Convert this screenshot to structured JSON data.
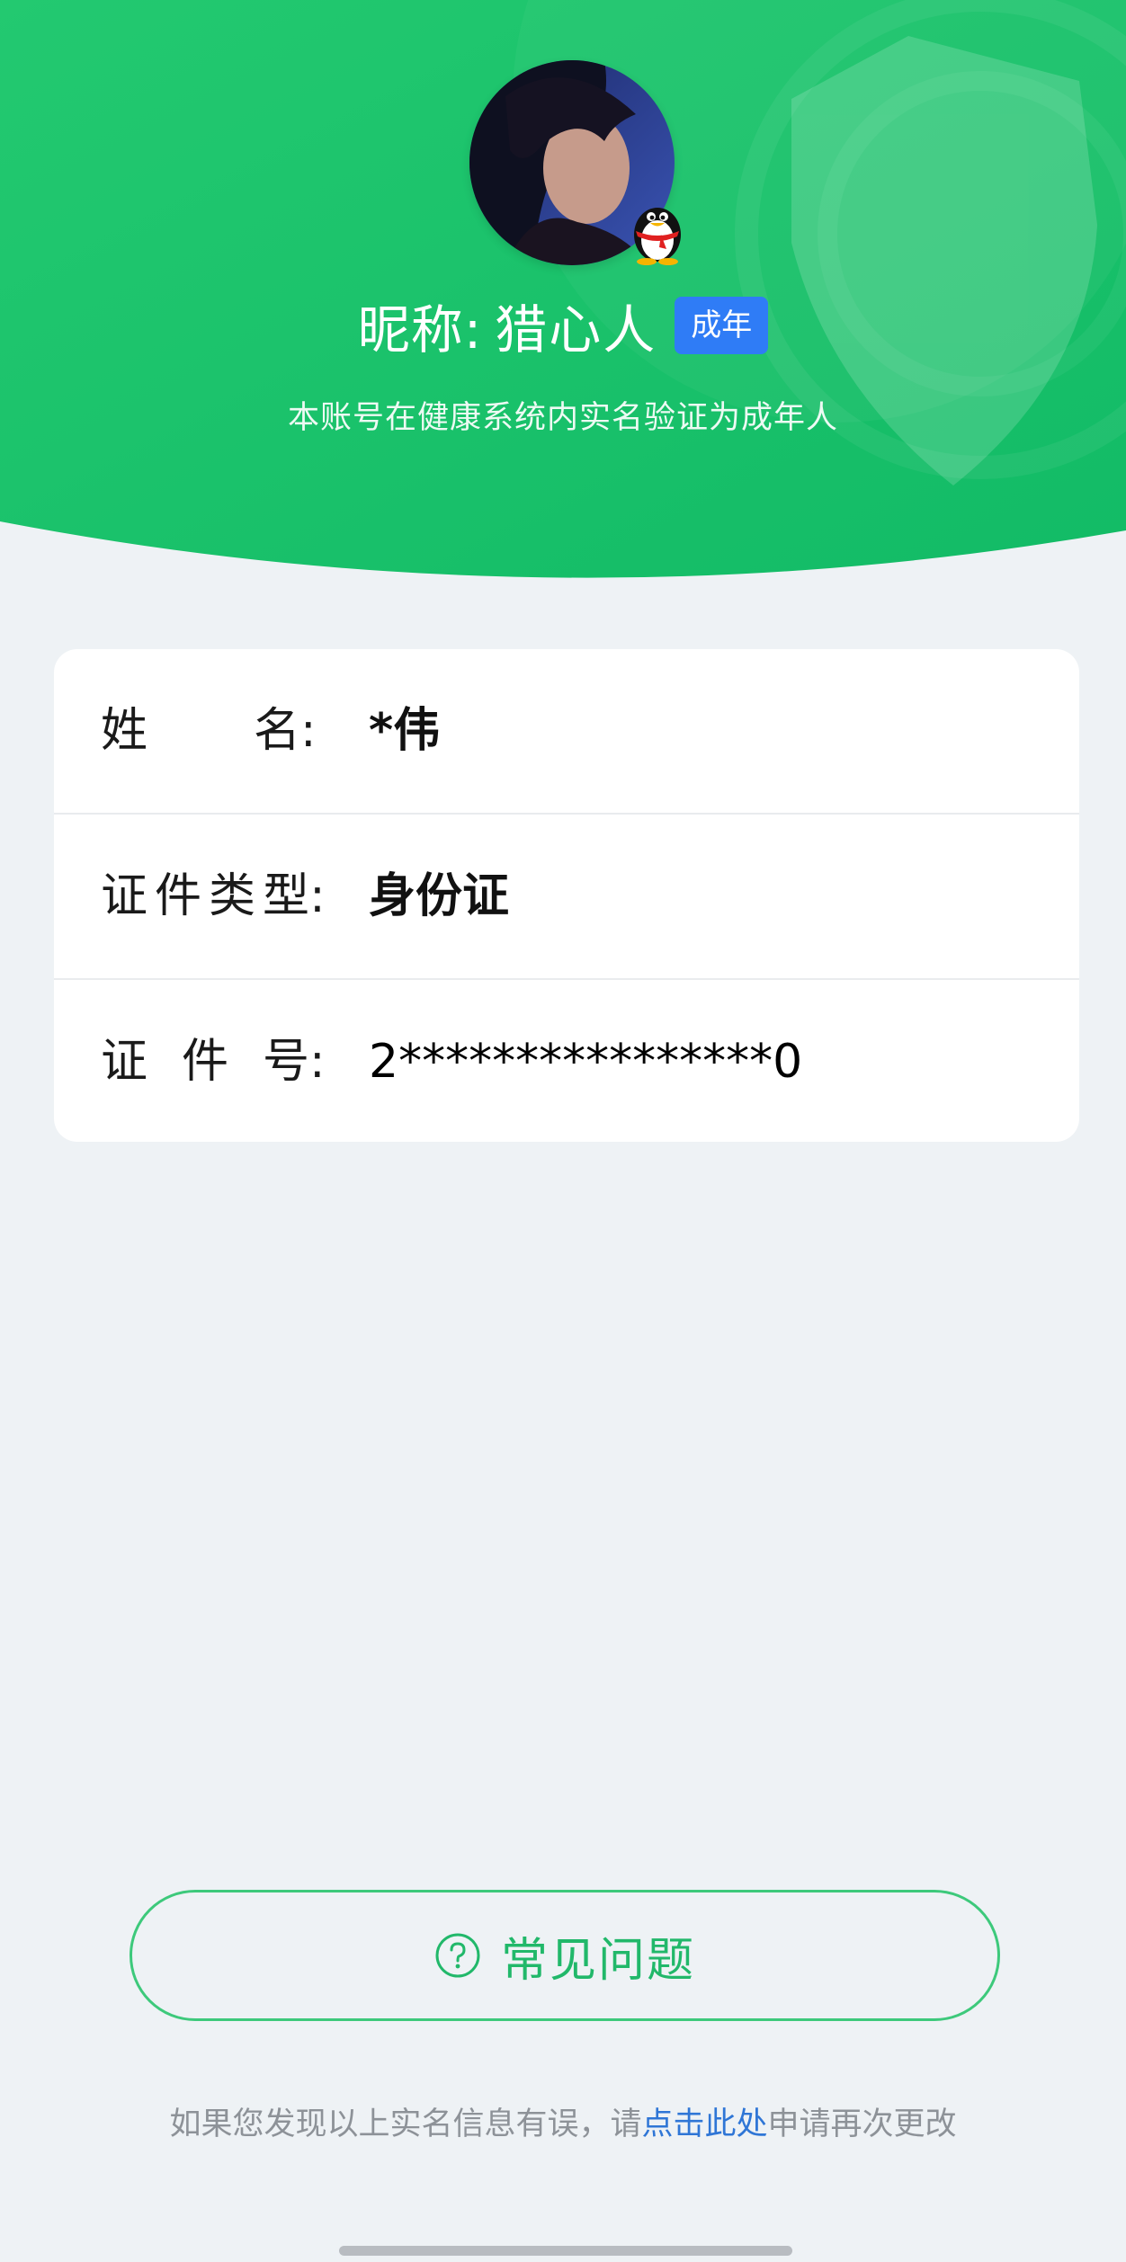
{
  "header": {
    "nickname_label": "昵称:",
    "nickname": "猎心人",
    "badge": "成年",
    "subtitle": "本账号在健康系统内实名验证为成年人",
    "accent_color": "#1ec46f"
  },
  "info_card": {
    "rows": [
      {
        "label_chars": [
          "姓",
          "名",
          ":"
        ],
        "value": "*伟"
      },
      {
        "label_chars": [
          "证",
          "件",
          "类",
          "型",
          ":"
        ],
        "value": "身份证"
      },
      {
        "label_chars": [
          "证",
          "件",
          "号",
          ":"
        ],
        "value": "2****************0"
      }
    ]
  },
  "faq": {
    "icon": "question-circle-icon",
    "label": "常见问题",
    "color": "#21b86a"
  },
  "footer": {
    "prefix": "如果您发现以上实名信息有误，请",
    "link": "点击此处",
    "suffix": "申请再次更改",
    "link_color": "#2f76d6"
  }
}
